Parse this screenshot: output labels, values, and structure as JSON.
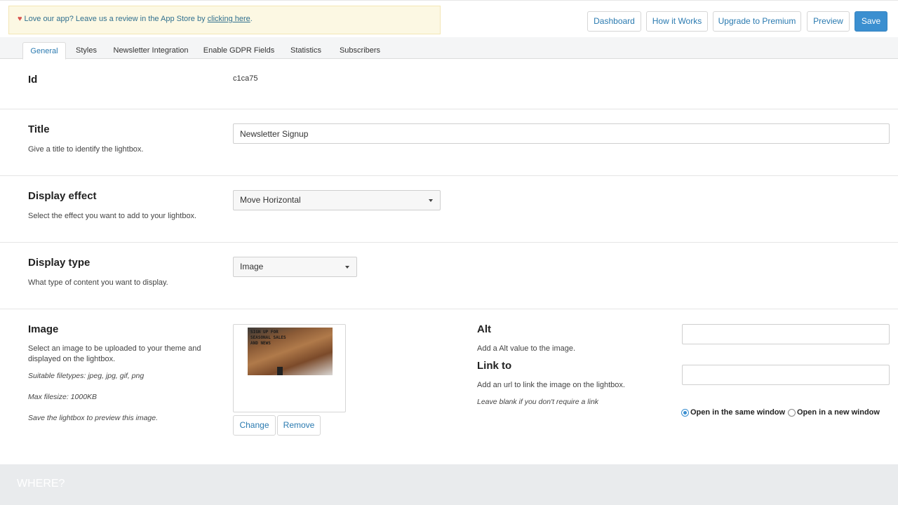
{
  "banner": {
    "heart": "♥",
    "text": "Love our app? Leave us a review in the App Store by ",
    "link": "clicking here",
    "suffix": "."
  },
  "header_buttons": {
    "dashboard": "Dashboard",
    "how_it_works": "How it Works",
    "upgrade": "Upgrade to Premium",
    "preview": "Preview",
    "save": "Save"
  },
  "tabs": [
    {
      "label": "General",
      "active": true
    },
    {
      "label": "Styles",
      "active": false
    },
    {
      "label": "Newsletter Integration",
      "active": false
    },
    {
      "label": "Enable GDPR Fields",
      "active": false
    },
    {
      "label": "Statistics",
      "active": false
    },
    {
      "label": "Subscribers",
      "active": false
    }
  ],
  "id_section": {
    "heading": "Id",
    "value": "c1ca75"
  },
  "title_section": {
    "heading": "Title",
    "description": "Give a title to identify the lightbox.",
    "value": "Newsletter Signup"
  },
  "effect_section": {
    "heading": "Display effect",
    "description": "Select the effect you want to add to your lightbox.",
    "selected": "Move Horizontal"
  },
  "type_section": {
    "heading": "Display type",
    "description": "What type of content you want to display.",
    "selected": "Image"
  },
  "image_section": {
    "heading": "Image",
    "description": "Select an image to be uploaded to your theme and displayed on the lightbox.",
    "filetypes": "Suitable filetypes: jpeg, jpg, gif, png",
    "filesize": "Max filesize: 1000KB",
    "preview_note": "Save the lightbox to preview this image.",
    "thumb_text_line1": "SIGN UP FOR",
    "thumb_text_line2": "SEASONAL SALES",
    "thumb_text_line3": "AND NEWS",
    "change_label": "Change",
    "remove_label": "Remove"
  },
  "alt_section": {
    "heading": "Alt",
    "description": "Add a Alt value to the image.",
    "value": ""
  },
  "link_section": {
    "heading": "Link to",
    "description": "Add an url to link the image on the lightbox.",
    "note": "Leave blank if you don't require a link",
    "value": "",
    "radio_same": "Open in the same window",
    "radio_new": "Open in a new window",
    "selected": "same"
  },
  "where_section": {
    "heading": "WHERE?"
  },
  "colors": {
    "accent": "#3b8fd0",
    "link": "#2a7ab0",
    "banner_bg": "#fcf8e3",
    "heart": "#d9534f"
  }
}
